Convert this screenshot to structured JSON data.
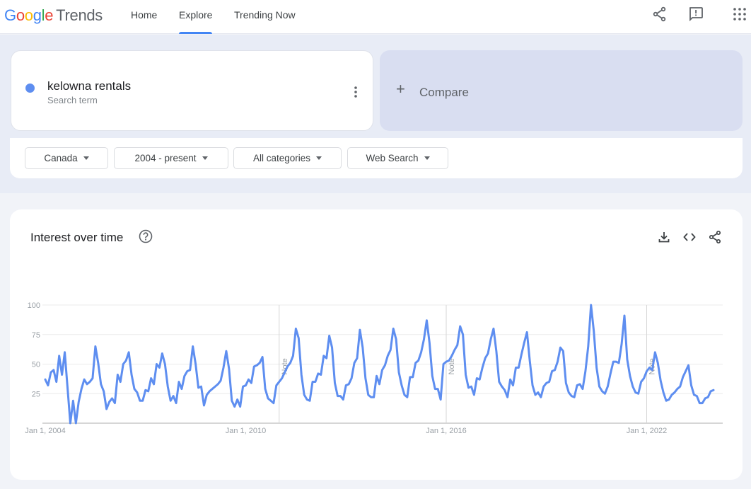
{
  "app": {
    "logo_parts": [
      "G",
      "o",
      "o",
      "g",
      "l",
      "e"
    ],
    "logo_product": "Trends"
  },
  "nav": {
    "items": [
      {
        "label": "Home",
        "active": false
      },
      {
        "label": "Explore",
        "active": true
      },
      {
        "label": "Trending Now",
        "active": false
      }
    ]
  },
  "top_icons": [
    "share-icon",
    "feedback-icon",
    "apps-grid-icon"
  ],
  "search": {
    "term": "kelowna rentals",
    "term_type": "Search term",
    "term_color": "#5e8ef0",
    "compare_label": "Compare"
  },
  "filters": [
    {
      "name": "region",
      "value": "Canada"
    },
    {
      "name": "time-range",
      "value": "2004 - present"
    },
    {
      "name": "category",
      "value": "All categories"
    },
    {
      "name": "search-type",
      "value": "Web Search"
    }
  ],
  "interest_card": {
    "title": "Interest over time",
    "actions": [
      "download-icon",
      "embed-code-icon",
      "share-icon"
    ]
  },
  "chart_data": {
    "type": "line",
    "title": "Interest over time",
    "xlabel": "",
    "ylabel": "",
    "ylim": [
      0,
      100
    ],
    "yticks": [
      25,
      50,
      75,
      100
    ],
    "x_tick_labels": [
      "Jan 1, 2004",
      "Jan 1, 2010",
      "Jan 1, 2016",
      "Jan 1, 2022"
    ],
    "x_tick_years": [
      2004,
      2010,
      2016,
      2022
    ],
    "start": "2004-01",
    "frequency": "monthly",
    "grid": true,
    "line_color": "#5e8ef0",
    "notes": [
      {
        "label": "Note",
        "date": "2011-01"
      },
      {
        "label": "Note",
        "date": "2016-01"
      },
      {
        "label": "Note",
        "date": "2022-01"
      }
    ],
    "series": [
      {
        "name": "kelowna rentals",
        "values": [
          37,
          32,
          43,
          45,
          35,
          57,
          41,
          60,
          30,
          0,
          19,
          0,
          18,
          29,
          37,
          33,
          35,
          38,
          65,
          51,
          33,
          27,
          12,
          18,
          21,
          17,
          41,
          35,
          50,
          53,
          60,
          41,
          29,
          26,
          19,
          19,
          28,
          27,
          38,
          33,
          50,
          47,
          59,
          50,
          31,
          19,
          23,
          17,
          35,
          29,
          40,
          44,
          45,
          65,
          50,
          30,
          31,
          15,
          24,
          27,
          29,
          31,
          33,
          36,
          47,
          61,
          46,
          19,
          14,
          20,
          14,
          31,
          32,
          37,
          34,
          48,
          49,
          51,
          56,
          29,
          21,
          19,
          17,
          32,
          35,
          38,
          43,
          48,
          51,
          57,
          80,
          72,
          41,
          24,
          20,
          19,
          35,
          35,
          42,
          41,
          57,
          55,
          74,
          64,
          34,
          23,
          23,
          20,
          32,
          33,
          38,
          51,
          55,
          79,
          64,
          38,
          24,
          22,
          22,
          40,
          33,
          45,
          49,
          57,
          62,
          80,
          71,
          43,
          32,
          24,
          22,
          39,
          39,
          51,
          53,
          60,
          71,
          87,
          68,
          40,
          29,
          29,
          20,
          50,
          52,
          53,
          57,
          62,
          66,
          82,
          75,
          41,
          30,
          31,
          24,
          38,
          37,
          47,
          55,
          59,
          71,
          80,
          61,
          35,
          31,
          28,
          22,
          37,
          32,
          47,
          47,
          58,
          68,
          77,
          53,
          32,
          24,
          26,
          22,
          31,
          34,
          35,
          44,
          45,
          52,
          64,
          61,
          34,
          26,
          23,
          22,
          32,
          33,
          29,
          44,
          65,
          100,
          78,
          47,
          31,
          27,
          25,
          31,
          42,
          52,
          52,
          51,
          67,
          91,
          54,
          40,
          31,
          26,
          25,
          35,
          38,
          44,
          47,
          45,
          60,
          51,
          36,
          26,
          19,
          20,
          24,
          26,
          29,
          31,
          39,
          44,
          49,
          32,
          24,
          23,
          17,
          17,
          21,
          22,
          27,
          28
        ]
      }
    ]
  }
}
